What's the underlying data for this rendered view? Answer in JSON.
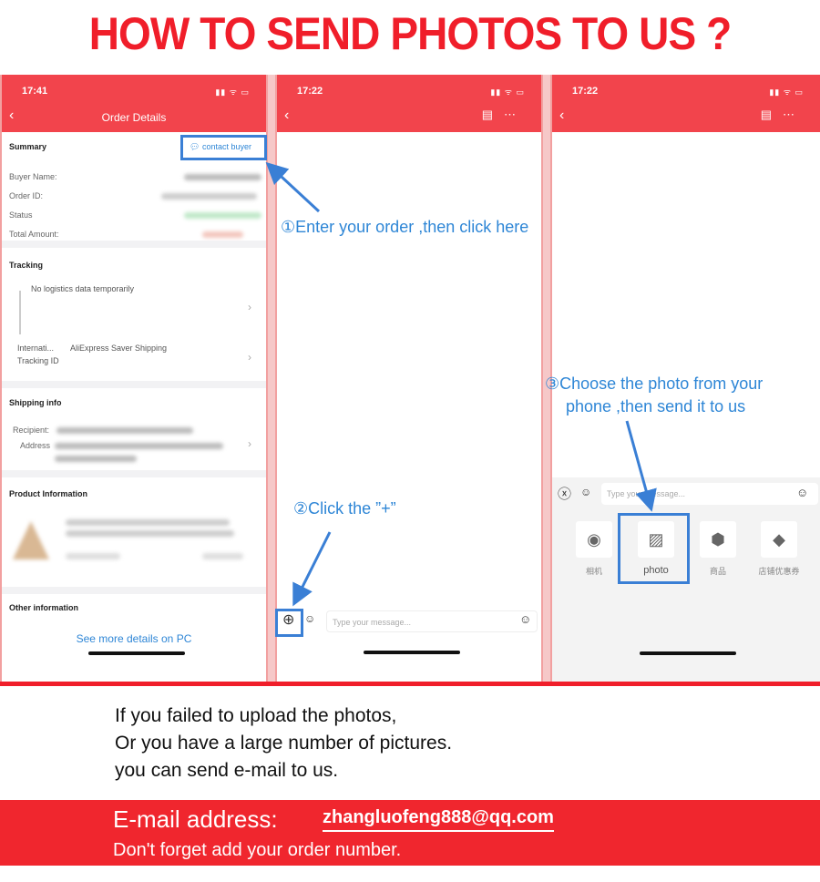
{
  "title": "HOW TO SEND PHOTOS TO US ?",
  "colors": {
    "brand_red": "#f2444c",
    "title_red": "#f01e2a",
    "annotation_blue": "#2e86d6"
  },
  "panel1": {
    "time": "17:41",
    "header": "Order Details",
    "summary": "Summary",
    "contact_buyer": "contact buyer",
    "fields": [
      "Buyer Name:",
      "Order ID:",
      "Status",
      "Total Amount:"
    ],
    "tracking": "Tracking",
    "no_logistics": "No logistics data temporarily",
    "intl": "Internati...",
    "shipping_method": "AliExpress Saver Shipping",
    "tracking_id": "Tracking ID",
    "shipping_info": "Shipping info",
    "recipient": "Recipient:",
    "address": "Address",
    "product_info": "Product Information",
    "other_info": "Other information",
    "see_more": "See more details on PC"
  },
  "panel2": {
    "time": "17:22",
    "input_placeholder": "Type your message..."
  },
  "panel3": {
    "time": "17:22",
    "input_placeholder": "Type your message...",
    "tools": [
      "相机",
      "photo",
      "商品",
      "店铺优惠券"
    ]
  },
  "annotations": {
    "step1": "①Enter your order ,then click here",
    "step2": "②Click the ”+”",
    "step3_line1": "③Choose the photo from your",
    "step3_line2": "phone ,then send it to us"
  },
  "footer": {
    "line1": "If you failed to upload the photos,",
    "line2": "Or you have a large number of pictures.",
    "line3": "you can send e-mail to us.",
    "email_label": "E-mail address:",
    "email": "zhangluofeng888@qq.com",
    "reminder": "Don't forget add your order number."
  }
}
